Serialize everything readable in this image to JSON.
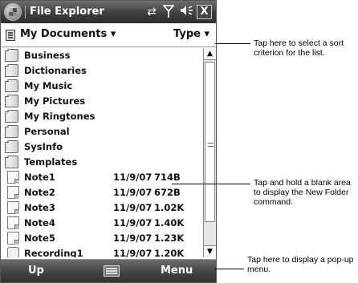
{
  "titlebar": {
    "title": "File Explorer",
    "icons": [
      "start-icon",
      "sync-icon",
      "signal-icon",
      "volume-icon",
      "close-icon"
    ],
    "close_label": "X"
  },
  "navbar": {
    "location": "My Documents ▾",
    "sort_label": "Type ▾"
  },
  "files": [
    {
      "name": "Business",
      "type": "folder"
    },
    {
      "name": "Dictionaries",
      "type": "folder"
    },
    {
      "name": "My Music",
      "type": "folder"
    },
    {
      "name": "My Pictures",
      "type": "folder"
    },
    {
      "name": "My Ringtones",
      "type": "folder"
    },
    {
      "name": "Personal",
      "type": "folder"
    },
    {
      "name": "SysInfo",
      "type": "folder"
    },
    {
      "name": "Templates",
      "type": "folder"
    },
    {
      "name": "Note1",
      "type": "note",
      "date": "11/9/07",
      "size": "714B"
    },
    {
      "name": "Note2",
      "type": "note",
      "date": "11/9/07",
      "size": "672B"
    },
    {
      "name": "Note3",
      "type": "note",
      "date": "11/9/07",
      "size": "1.02K"
    },
    {
      "name": "Note4",
      "type": "note",
      "date": "11/9/07",
      "size": "1.40K"
    },
    {
      "name": "Note5",
      "type": "note",
      "date": "11/9/07",
      "size": "1.23K"
    },
    {
      "name": "Recording1",
      "type": "audio",
      "date": "11/9/07",
      "size": "1.20K"
    }
  ],
  "softkeys": {
    "left": "Up",
    "right": "Menu"
  },
  "callouts": [
    "Tap here to select a sort criterion for the list.",
    "Tap and hold a blank area to display the New Folder command.",
    "Tap here to display a pop-up menu."
  ]
}
